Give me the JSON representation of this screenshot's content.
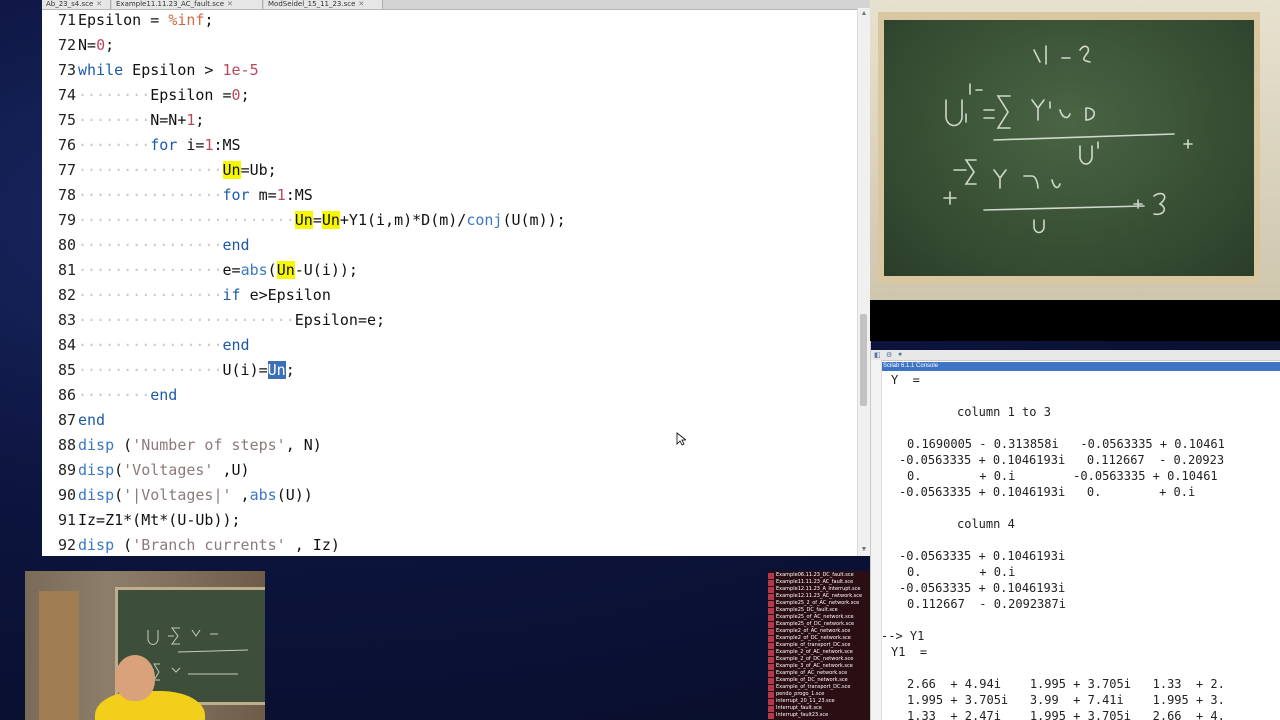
{
  "editor": {
    "tabs": [
      {
        "label": "Ab_23_s4.sce"
      },
      {
        "label": "Example11.11.23_AC_fault.sce"
      },
      {
        "label": "ModSeidel_15_11_23.sce"
      }
    ],
    "lines": [
      {
        "num": "71",
        "indent": "",
        "tokens": [
          {
            "t": "Epsilon = "
          },
          {
            "t": "%inf",
            "c": "op"
          },
          {
            "t": ";"
          }
        ]
      },
      {
        "num": "72",
        "indent": "",
        "tokens": [
          {
            "t": "N="
          },
          {
            "t": "0",
            "c": "num"
          },
          {
            "t": ";"
          }
        ]
      },
      {
        "num": "73",
        "indent": "",
        "tokens": [
          {
            "t": "while",
            "c": "kw"
          },
          {
            "t": " Epsilon > "
          },
          {
            "t": "1e-5",
            "c": "num"
          }
        ]
      },
      {
        "num": "74",
        "indent": "········",
        "tokens": [
          {
            "t": "Epsilon ="
          },
          {
            "t": "0",
            "c": "num"
          },
          {
            "t": ";"
          }
        ]
      },
      {
        "num": "75",
        "indent": "········",
        "tokens": [
          {
            "t": "N=N+"
          },
          {
            "t": "1",
            "c": "num"
          },
          {
            "t": ";"
          }
        ]
      },
      {
        "num": "76",
        "indent": "········",
        "tokens": [
          {
            "t": "for",
            "c": "kw"
          },
          {
            "t": " i="
          },
          {
            "t": "1",
            "c": "num"
          },
          {
            "t": ":MS"
          }
        ]
      },
      {
        "num": "77",
        "indent": "················",
        "tokens": [
          {
            "t": "Un",
            "c": "hl"
          },
          {
            "t": "=Ub;"
          }
        ]
      },
      {
        "num": "78",
        "indent": "················",
        "tokens": [
          {
            "t": "for",
            "c": "kw"
          },
          {
            "t": " m="
          },
          {
            "t": "1",
            "c": "num"
          },
          {
            "t": ":MS"
          }
        ]
      },
      {
        "num": "79",
        "indent": "························",
        "tokens": [
          {
            "t": "Un",
            "c": "hl"
          },
          {
            "t": "="
          },
          {
            "t": "Un",
            "c": "hl"
          },
          {
            "t": "+Y1(i,m)*D(m)/"
          },
          {
            "t": "conj",
            "c": "fn"
          },
          {
            "t": "(U(m));"
          }
        ]
      },
      {
        "num": "80",
        "indent": "················",
        "tokens": [
          {
            "t": "end",
            "c": "kw"
          }
        ]
      },
      {
        "num": "81",
        "indent": "················",
        "tokens": [
          {
            "t": "e="
          },
          {
            "t": "abs",
            "c": "fn"
          },
          {
            "t": "("
          },
          {
            "t": "Un",
            "c": "hl"
          },
          {
            "t": "-U(i));"
          }
        ]
      },
      {
        "num": "82",
        "indent": "················",
        "tokens": [
          {
            "t": "if",
            "c": "kw"
          },
          {
            "t": " e>Epsilon"
          }
        ]
      },
      {
        "num": "83",
        "indent": "························",
        "tokens": [
          {
            "t": "Epsilon=e;"
          }
        ]
      },
      {
        "num": "84",
        "indent": "················",
        "tokens": [
          {
            "t": "end",
            "c": "kw"
          }
        ]
      },
      {
        "num": "85",
        "indent": "················",
        "tokens": [
          {
            "t": "U(i)="
          },
          {
            "t": "Un",
            "c": "sel"
          },
          {
            "t": ";"
          }
        ]
      },
      {
        "num": "86",
        "indent": "········",
        "tokens": [
          {
            "t": "end",
            "c": "kw"
          }
        ]
      },
      {
        "num": "87",
        "indent": "",
        "tokens": [
          {
            "t": "end",
            "c": "kw"
          }
        ]
      },
      {
        "num": "88",
        "indent": "",
        "tokens": [
          {
            "t": "disp",
            "c": "fn"
          },
          {
            "t": " ("
          },
          {
            "t": "'Number of steps'",
            "c": "str"
          },
          {
            "t": ", N)"
          }
        ]
      },
      {
        "num": "89",
        "indent": "",
        "tokens": [
          {
            "t": "disp",
            "c": "fn"
          },
          {
            "t": "("
          },
          {
            "t": "'Voltages'",
            "c": "str"
          },
          {
            "t": " ,U)"
          }
        ]
      },
      {
        "num": "90",
        "indent": "",
        "tokens": [
          {
            "t": "disp",
            "c": "fn"
          },
          {
            "t": "("
          },
          {
            "t": "'|Voltages|'",
            "c": "str"
          },
          {
            "t": " ,"
          },
          {
            "t": "abs",
            "c": "fn"
          },
          {
            "t": "(U))"
          }
        ]
      },
      {
        "num": "91",
        "indent": "",
        "tokens": [
          {
            "t": "Iz=Z1*(Mt*(U-Ub));"
          }
        ]
      },
      {
        "num": "92",
        "indent": "",
        "tokens": [
          {
            "t": "disp",
            "c": "fn"
          },
          {
            "t": " ("
          },
          {
            "t": "'Branch currents'",
            "c": "str"
          },
          {
            "t": " , Iz)"
          }
        ]
      }
    ]
  },
  "console": {
    "title": "Scilab 6.1.1 Console",
    "lines": [
      {
        "x": 10,
        "text": "Y  ="
      },
      {
        "x": 0,
        "text": ""
      },
      {
        "x": 76,
        "text": "column 1 to 3"
      },
      {
        "x": 0,
        "text": ""
      },
      {
        "x": 26,
        "text": "0.1690005 - 0.313858i   -0.0563335 + 0.10461"
      },
      {
        "x": 18,
        "text": "-0.0563335 + 0.1046193i   0.112667  - 0.20923"
      },
      {
        "x": 26,
        "text": "0.        + 0.i        -0.0563335 + 0.10461"
      },
      {
        "x": 18,
        "text": "-0.0563335 + 0.1046193i   0.        + 0.i"
      },
      {
        "x": 0,
        "text": ""
      },
      {
        "x": 76,
        "text": "column 4"
      },
      {
        "x": 0,
        "text": ""
      },
      {
        "x": 18,
        "text": "-0.0563335 + 0.1046193i"
      },
      {
        "x": 26,
        "text": "0.        + 0.i"
      },
      {
        "x": 18,
        "text": "-0.0563335 + 0.1046193i"
      },
      {
        "x": 26,
        "text": "0.112667  - 0.2092387i"
      },
      {
        "x": 0,
        "text": ""
      },
      {
        "x": 0,
        "text": "--> Y1"
      },
      {
        "x": 10,
        "text": "Y1  ="
      },
      {
        "x": 0,
        "text": ""
      },
      {
        "x": 26,
        "text": "2.66  + 4.94i    1.995 + 3.705i   1.33  + 2."
      },
      {
        "x": 26,
        "text": "1.995 + 3.705i   3.99  + 7.41i    1.995 + 3."
      },
      {
        "x": 26,
        "text": "1.33  + 2.47i    1.995 + 3.705i   2.66  + 4."
      }
    ]
  },
  "filelist": [
    "Example06.11.23_DC_fault.sce",
    "Example11.11.23_AC_fault.sce",
    "Example12.11.23_A_Interrupt.sce",
    "Example12.11.23_AC_network.sce",
    "Example25_2_of_AC_network.sce",
    "Example25_DC_fault.sce",
    "Example25_of_AC_network.sce",
    "Example25_of_DC_network.sce",
    "Example2_of_AC_network.sce",
    "Example2_of_DC_network.sce",
    "Example_of_transport_DC.sce",
    "Example_2_of_AC_network.sce",
    "Example_2_of_DC_network.sce",
    "Example_3_of_AC_network.sce",
    "Example_of_AC_network.sce",
    "Example_of_DC_network.sce",
    "Example_of_transport_DC.sce",
    "pendo_progo_1.sce",
    "interrupt_20_11_23.sce",
    "Interrupt_fault.sce",
    "Interrupt_fault23.sce"
  ]
}
